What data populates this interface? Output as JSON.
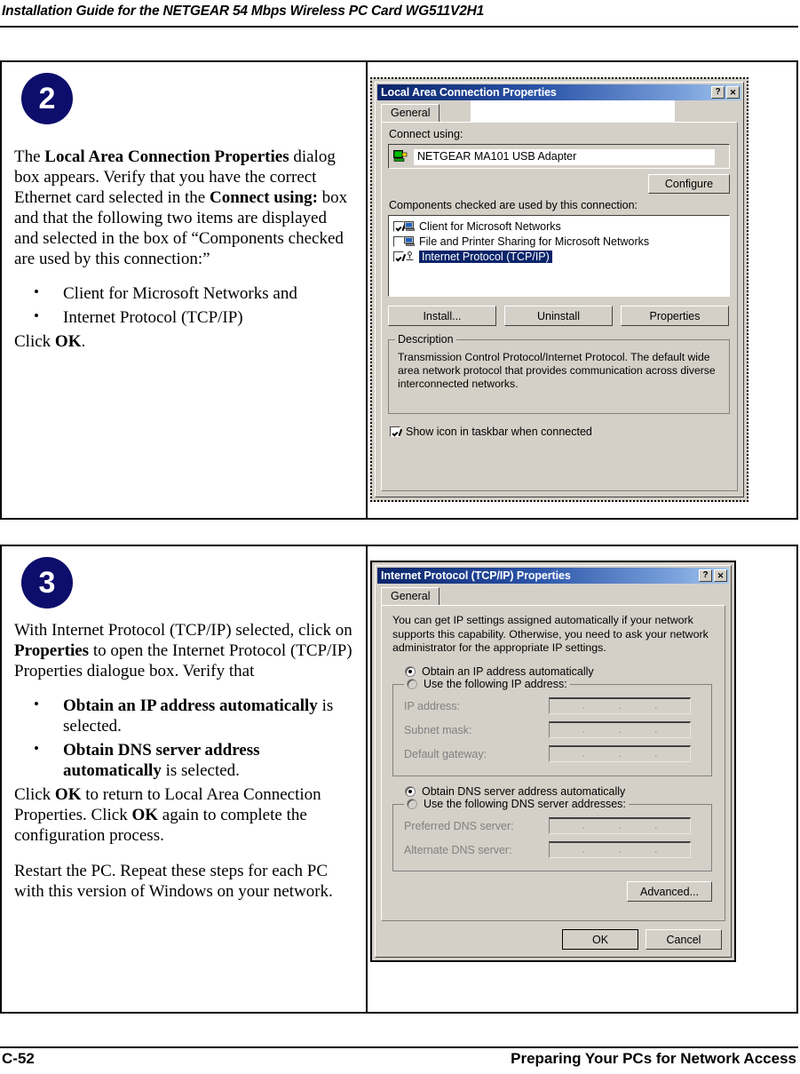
{
  "header": {
    "running_head": "Installation Guide for the NETGEAR 54 Mbps Wireless PC Card WG511V2H1"
  },
  "footer": {
    "page_number": "C-52",
    "section_title": "Preparing Your PCs for Network Access"
  },
  "steps": [
    {
      "badge": "2",
      "paragraph_1_lead": "The ",
      "paragraph_1_bold_1": "Local Area Connection Properties",
      "paragraph_1_mid_1": " dialog box appears.  Verify that you have the correct Ethernet card selected in the ",
      "paragraph_1_bold_2": "Connect using:",
      "paragraph_1_tail": " box and that the following two items are displayed and selected in the box of “Components checked are used by this connection:”",
      "bullets": [
        "Client for Microsoft Networks and",
        "Internet Protocol (TCP/IP)"
      ],
      "paragraph_2_lead": "Click ",
      "paragraph_2_bold": "OK",
      "paragraph_2_tail": "."
    },
    {
      "badge": "3",
      "paragraph_1_lead": "With Internet Protocol (TCP/IP) selected, click on ",
      "paragraph_1_bold": "Properties",
      "paragraph_1_tail": " to open the Internet Protocol (TCP/IP) Properties dialogue box. Verify that",
      "bullets": [
        {
          "bold": "Obtain an IP address automatically",
          "tail": " is selected."
        },
        {
          "bold": "Obtain DNS server address automatically",
          "tail": " is selected."
        }
      ],
      "paragraph_2_lead": "Click ",
      "paragraph_2_bold_1": "OK",
      "paragraph_2_mid": " to return to Local Area Connection Properties. Click ",
      "paragraph_2_bold_2": "OK",
      "paragraph_2_tail": " again to complete the configuration process.",
      "paragraph_3": "Restart the PC. Repeat these steps for each PC with this version of Windows on your network."
    }
  ],
  "dialog_lac": {
    "title": "Local Area Connection Properties",
    "help_button": "?",
    "close_button": "✕",
    "tab_general": "General",
    "connect_using_label": "Connect using:",
    "adapter_name": "NETGEAR MA101 USB Adapter",
    "configure_button": "Configure",
    "components_label": "Components checked are used by this connection:",
    "components": [
      {
        "checked": true,
        "label": "Client for Microsoft Networks",
        "selected": false
      },
      {
        "checked": false,
        "label": "File and Printer Sharing for Microsoft Networks",
        "selected": false
      },
      {
        "checked": true,
        "label": "Internet Protocol (TCP/IP)",
        "selected": true
      }
    ],
    "install_button": "Install...",
    "uninstall_button": "Uninstall",
    "properties_button": "Properties",
    "description_group": "Description",
    "description_text": "Transmission Control Protocol/Internet Protocol. The default wide area network protocol that provides communication across diverse interconnected networks.",
    "taskbar_checkbox_label": "Show icon in taskbar when connected",
    "taskbar_checkbox_checked": true
  },
  "dialog_tcpip": {
    "title": "Internet Protocol (TCP/IP) Properties",
    "help_button": "?",
    "close_button": "✕",
    "tab_general": "General",
    "intro_text": "You can get IP settings assigned automatically if your network supports this capability. Otherwise, you need to ask your network administrator for the appropriate IP settings.",
    "radio_obtain_ip": {
      "label": "Obtain an IP address automatically",
      "selected": true
    },
    "radio_use_ip": {
      "label": "Use the following IP address:",
      "selected": false
    },
    "ip_fields": [
      {
        "label": "IP address:",
        "value": ""
      },
      {
        "label": "Subnet mask:",
        "value": ""
      },
      {
        "label": "Default gateway:",
        "value": ""
      }
    ],
    "radio_obtain_dns": {
      "label": "Obtain DNS server address automatically",
      "selected": true
    },
    "radio_use_dns": {
      "label": "Use the following DNS server addresses:",
      "selected": false
    },
    "dns_fields": [
      {
        "label": "Preferred DNS server:",
        "value": ""
      },
      {
        "label": "Alternate DNS server:",
        "value": ""
      }
    ],
    "advanced_button": "Advanced...",
    "ok_button": "OK",
    "cancel_button": "Cancel"
  },
  "colors": {
    "badge_navy": "#0d0d6b",
    "title_navy": "#0a246a",
    "dialog_face": "#d4d0c8",
    "selection_blue": "#0a246a"
  }
}
